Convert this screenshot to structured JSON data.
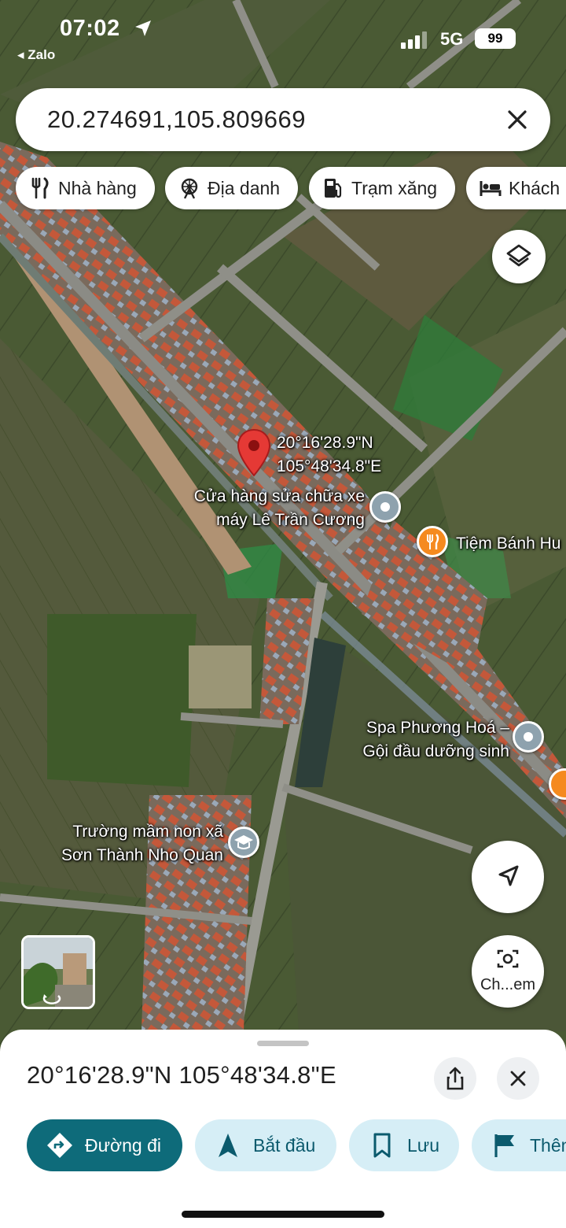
{
  "status_bar": {
    "time": "07:02",
    "back_app": "◂ Zalo",
    "network": "5G",
    "battery": "99"
  },
  "search": {
    "query": "20.274691,105.809669"
  },
  "chips": [
    {
      "label": "Nhà hàng",
      "icon": "fork-knife-icon"
    },
    {
      "label": "Địa danh",
      "icon": "ferris-wheel-icon"
    },
    {
      "label": "Trạm xăng",
      "icon": "gas-pump-icon"
    },
    {
      "label": "Khách",
      "icon": "bed-icon"
    }
  ],
  "map": {
    "pin_label_lat": "20°16'28.9\"N",
    "pin_label_lng": "105°48'34.8\"E",
    "pois": {
      "shop": [
        "Cửa hàng sửa chữa xe",
        "máy Lê Trần Cương"
      ],
      "bakery": "Tiệm Bánh Hu",
      "spa": [
        "Spa Phương Hoá –",
        "Gội đầu dưỡng sinh"
      ],
      "school": [
        "Trường mầm non xã",
        "Sơn Thành Nho Quan"
      ]
    },
    "lens_label": "Ch...em",
    "colors": {
      "pin": "#e53935",
      "food_poi": "#f58a1f",
      "generic_poi": "#8ea2ae",
      "school_poi": "#8ea2ae"
    }
  },
  "sheet": {
    "title": "20°16'28.9\"N 105°48'34.8\"E",
    "actions": [
      {
        "label": "Đường đi",
        "icon": "directions-icon"
      },
      {
        "label": "Bắt đầu",
        "icon": "navigation-arrow-icon"
      },
      {
        "label": "Lưu",
        "icon": "bookmark-icon"
      },
      {
        "label": "Thêm",
        "icon": "flag-icon"
      }
    ],
    "accent": "#0e6b7a"
  }
}
